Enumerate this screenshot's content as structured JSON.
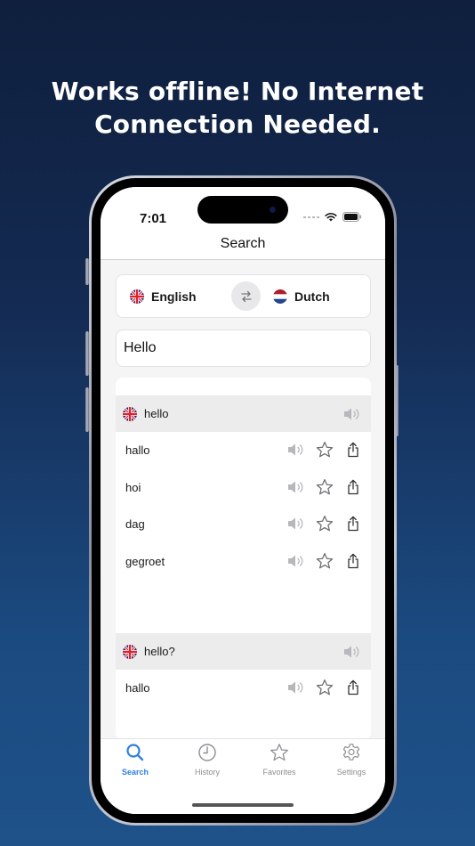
{
  "headline": {
    "line1": "Works offline! No Internet",
    "line2": "Connection Needed."
  },
  "status_bar": {
    "time": "7:01",
    "icons": [
      "signal-dots-icon",
      "wifi-icon",
      "battery-icon"
    ]
  },
  "nav": {
    "title": "Search"
  },
  "language_selector": {
    "source": {
      "label": "English",
      "flag": "uk-flag-icon"
    },
    "swap_icon": "swap-arrows-icon",
    "target": {
      "label": "Dutch",
      "flag": "netherlands-flag-icon"
    }
  },
  "search": {
    "value": "Hello",
    "placeholder": ""
  },
  "results": [
    {
      "term": "hello",
      "flag": "uk-flag-icon",
      "translations": [
        "hallo",
        "hoi",
        "dag",
        "gegroet"
      ]
    },
    {
      "term": "hello?",
      "flag": "uk-flag-icon",
      "translations": [
        "hallo"
      ]
    }
  ],
  "row_actions": [
    "speaker-icon",
    "star-icon",
    "share-icon"
  ],
  "tabs": [
    {
      "label": "Search",
      "icon": "magnifier-icon",
      "active": true
    },
    {
      "label": "History",
      "icon": "clock-icon",
      "active": false
    },
    {
      "label": "Favorites",
      "icon": "star-icon",
      "active": false
    },
    {
      "label": "Settings",
      "icon": "gear-icon",
      "active": false
    }
  ],
  "colors": {
    "accent": "#2f7fe0",
    "inactive_tab": "#8e8e93",
    "group_header_bg": "#ececed",
    "background_top": "#0f1f3d",
    "background_bottom": "#1e5289"
  }
}
